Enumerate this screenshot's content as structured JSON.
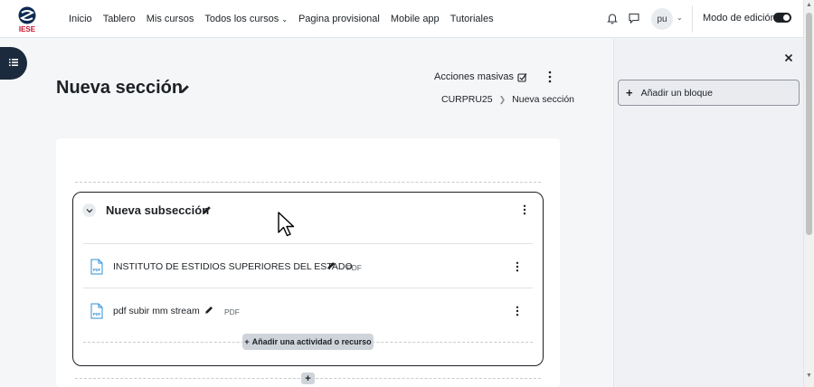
{
  "brand": {
    "logo_text": "IESE"
  },
  "nav": {
    "links": [
      {
        "label": "Inicio",
        "has_caret": false
      },
      {
        "label": "Tablero",
        "has_caret": false
      },
      {
        "label": "Mis cursos",
        "has_caret": false
      },
      {
        "label": "Todos los cursos",
        "has_caret": true
      },
      {
        "label": "Pagina provisional",
        "has_caret": false
      },
      {
        "label": "Mobile app",
        "has_caret": false
      },
      {
        "label": "Tutoriales",
        "has_caret": false
      }
    ],
    "user_initials": "pu",
    "edit_mode_label": "Modo de edición",
    "edit_mode_on": true
  },
  "page": {
    "title": "Nueva sección",
    "bulk_actions_label": "Acciones masivas",
    "breadcrumb": [
      "CURPRU25",
      "Nueva sección"
    ]
  },
  "subsection": {
    "title": "Nueva subsección",
    "activities": [
      {
        "name": "INSTITUTO DE ESTIDIOS SUPERIORES DEL ESTADO",
        "type_badge": "PDF",
        "icon": "pdf-icon"
      },
      {
        "name": "pdf subir mm stream",
        "type_badge": "PDF",
        "icon": "pdf-icon"
      }
    ],
    "add_activity_label": "Añadir una actividad o recurso"
  },
  "add_section_label": "+",
  "drawer": {
    "add_block_label": "Añadir un bloque"
  },
  "colors": {
    "accent_dark": "#1b2a3c",
    "pdf_blue": "#2f8fd6",
    "brand_red": "#c8102e",
    "brand_navy": "#0d2a52"
  }
}
